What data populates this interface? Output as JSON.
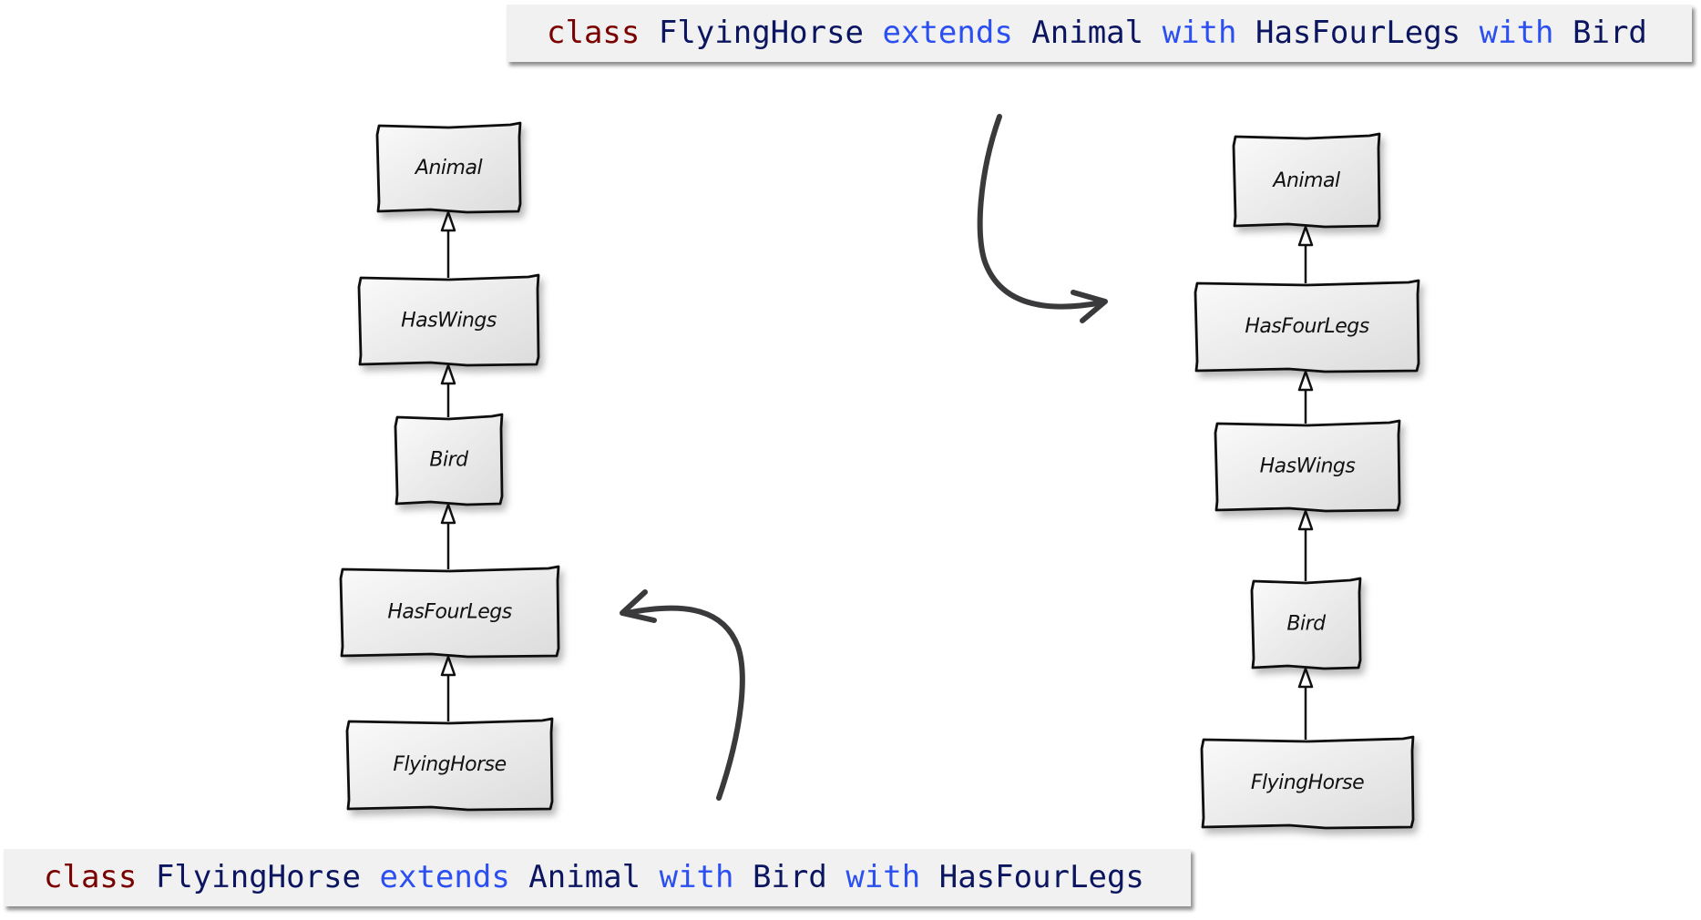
{
  "code_top": {
    "tokens": [
      {
        "text": "class",
        "kind": "class-keyword"
      },
      {
        "text": " ",
        "kind": "space"
      },
      {
        "text": "FlyingHorse",
        "kind": "identifier"
      },
      {
        "text": " ",
        "kind": "space"
      },
      {
        "text": "extends",
        "kind": "keyword"
      },
      {
        "text": " ",
        "kind": "space"
      },
      {
        "text": "Animal",
        "kind": "identifier"
      },
      {
        "text": " ",
        "kind": "space"
      },
      {
        "text": "with",
        "kind": "keyword"
      },
      {
        "text": " ",
        "kind": "space"
      },
      {
        "text": "HasFourLegs",
        "kind": "identifier"
      },
      {
        "text": " ",
        "kind": "space"
      },
      {
        "text": "with",
        "kind": "keyword"
      },
      {
        "text": " ",
        "kind": "space"
      },
      {
        "text": "Bird",
        "kind": "identifier"
      }
    ]
  },
  "code_bottom": {
    "tokens": [
      {
        "text": "class",
        "kind": "class-keyword"
      },
      {
        "text": " ",
        "kind": "space"
      },
      {
        "text": "FlyingHorse",
        "kind": "identifier"
      },
      {
        "text": " ",
        "kind": "space"
      },
      {
        "text": "extends",
        "kind": "keyword"
      },
      {
        "text": " ",
        "kind": "space"
      },
      {
        "text": "Animal",
        "kind": "identifier"
      },
      {
        "text": " ",
        "kind": "space"
      },
      {
        "text": "with",
        "kind": "keyword"
      },
      {
        "text": " ",
        "kind": "space"
      },
      {
        "text": "Bird",
        "kind": "identifier"
      },
      {
        "text": " ",
        "kind": "space"
      },
      {
        "text": "with",
        "kind": "keyword"
      },
      {
        "text": " ",
        "kind": "space"
      },
      {
        "text": "HasFourLegs",
        "kind": "identifier"
      }
    ]
  },
  "colors": {
    "class_keyword": "#7a0000",
    "keyword": "#2b4ff0",
    "identifier": "#0b1560",
    "code_background": "#f1f1f1",
    "box_fill_top": "#fafafa",
    "box_fill_bottom": "#dcdcdc",
    "box_stroke": "#111111",
    "arrow": "#3a3a3c"
  },
  "left_hierarchy": {
    "nodes": [
      "Animal",
      "HasWings",
      "Bird",
      "HasFourLegs",
      "FlyingHorse"
    ],
    "relation": "inherits-from-above"
  },
  "right_hierarchy": {
    "nodes": [
      "Animal",
      "HasFourLegs",
      "HasWings",
      "Bird",
      "FlyingHorse"
    ],
    "relation": "inherits-from-above"
  },
  "annotations": [
    {
      "name": "curved-arrow-top",
      "from": "code_top",
      "to": "right_hierarchy"
    },
    {
      "name": "curved-arrow-bottom",
      "from": "code_bottom",
      "to": "left_hierarchy"
    }
  ]
}
